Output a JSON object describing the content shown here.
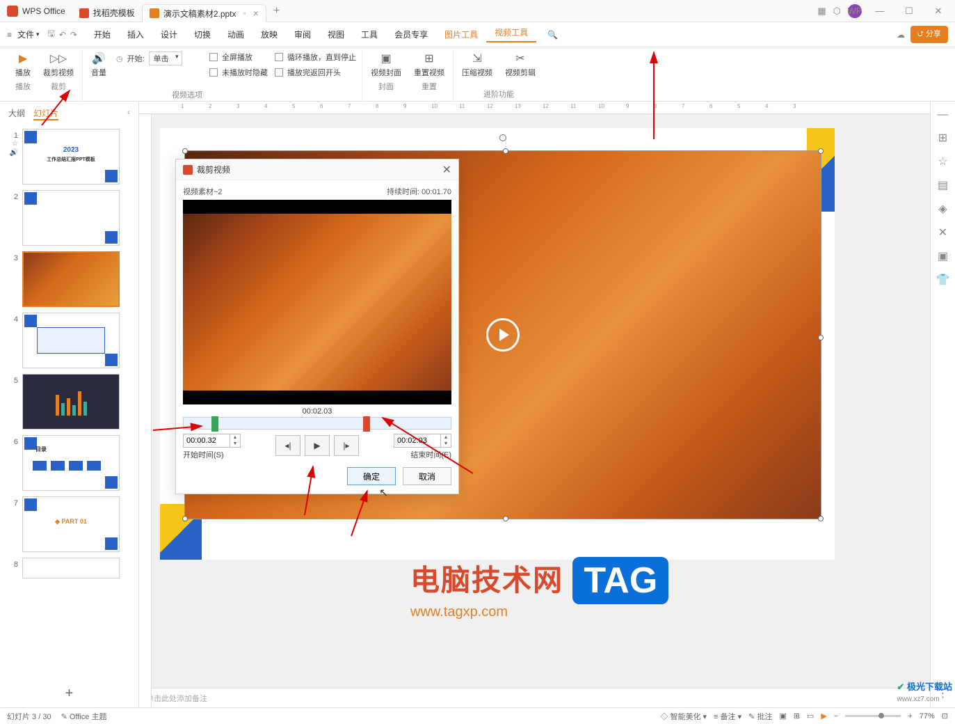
{
  "title_bar": {
    "app_name": "WPS Office",
    "tabs": [
      {
        "label": "找稻壳模板",
        "icon": "red",
        "active": false
      },
      {
        "label": "演示文稿素材2.pptx",
        "icon": "orange",
        "active": true
      }
    ]
  },
  "menu": {
    "file": "文件",
    "items": [
      "开始",
      "插入",
      "设计",
      "切换",
      "动画",
      "放映",
      "审阅",
      "视图",
      "工具",
      "会员专享"
    ],
    "tool_items": [
      "图片工具",
      "视频工具"
    ],
    "active_tool": "视频工具",
    "share": "分享"
  },
  "ribbon": {
    "play": {
      "btn1": "播放",
      "btn2": "裁剪视频",
      "footer1": "播放",
      "footer2": "裁剪"
    },
    "volume": {
      "label": "音量",
      "start_label": "开始:",
      "start_value": "单击",
      "cb_fullscreen": "全屏播放",
      "cb_hide": "未播放时隐藏",
      "cb_loop": "循环播放，直到停止",
      "cb_rewind": "播放完返回开头",
      "footer": "视频选项"
    },
    "cover": {
      "btn": "视频封面",
      "reset": "重置视频",
      "footer1": "封面",
      "footer2": "重置"
    },
    "advanced": {
      "compress": "压缩视频",
      "edit": "视频剪辑",
      "footer": "进阶功能"
    }
  },
  "sidebar": {
    "tab1": "大纲",
    "tab2": "幻灯片",
    "slide1_year": "2023",
    "slide1_title": "工作总结汇报PPT模板",
    "slide6_title": "目录",
    "slide7_part": "PART 01"
  },
  "dialog": {
    "title": "裁剪视频",
    "source": "视频素材~2",
    "duration_label": "持续时间:",
    "duration": "00:01.70",
    "current_time": "00:02.03",
    "start_value": "00:00.32",
    "start_label": "开始时间(S)",
    "end_value": "00:02.03",
    "end_label": "结束时间(E)",
    "ok": "确定",
    "cancel": "取消"
  },
  "notes_placeholder": "单击此处添加备注",
  "status": {
    "slide_info": "幻灯片 3 / 30",
    "theme": "Office 主题",
    "beautify": "智能美化",
    "remarks": "备注",
    "annotate": "批注",
    "zoom": "77%"
  },
  "watermark": {
    "title": "电脑技术网",
    "url": "www.tagxp.com",
    "tag": "TAG",
    "site2": "极光下载站",
    "site2_url": "www.xz7.com"
  }
}
